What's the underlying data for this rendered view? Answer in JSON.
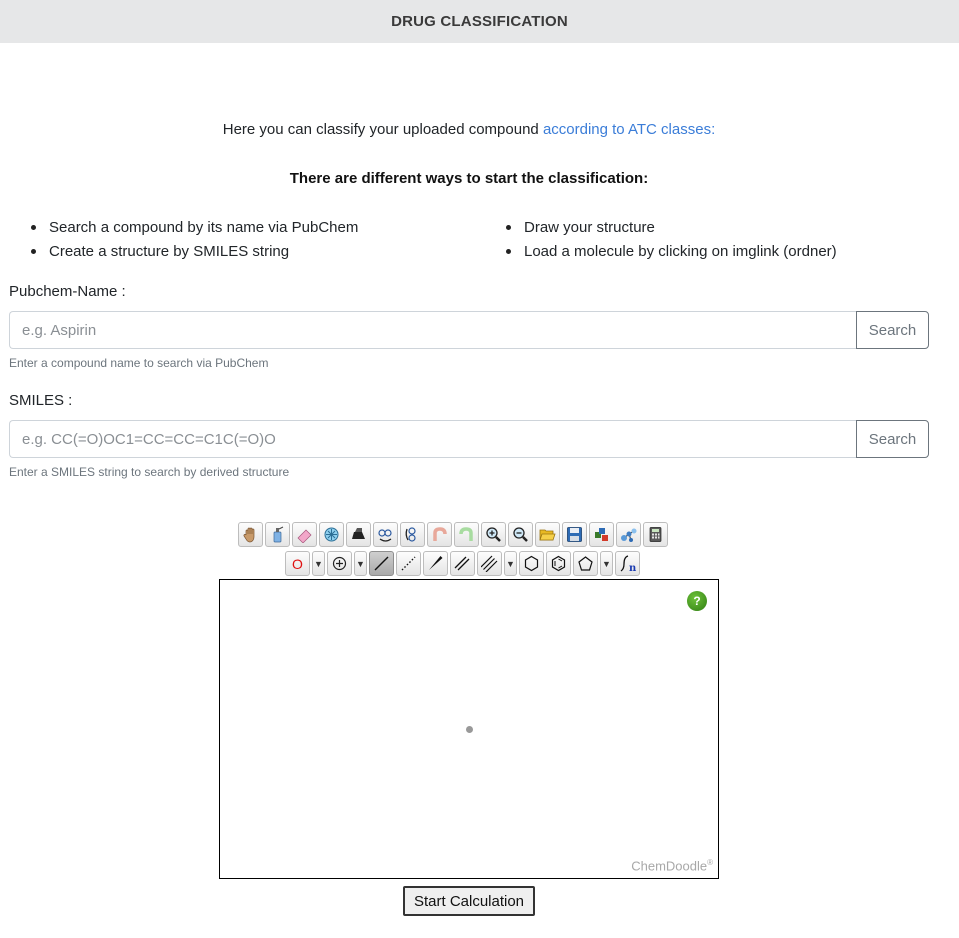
{
  "header": {
    "title": "DRUG CLASSIFICATION"
  },
  "intro": {
    "text": "Here you can classify your uploaded compound ",
    "link_text": "according to ATC classes:"
  },
  "ways": {
    "heading": "There are different ways to start the classification:",
    "left": [
      "Search a compound by its name via PubChem",
      "Create a structure by SMILES string"
    ],
    "right": [
      "Draw your structure",
      "Load a molecule by clicking on imglink (ordner)"
    ]
  },
  "pubchem": {
    "label": "Pubchem-Name :",
    "placeholder": "e.g. Aspirin",
    "button": "Search",
    "help": "Enter a compound name to search via PubChem"
  },
  "smiles": {
    "label": "SMILES :",
    "placeholder": "e.g. CC(=O)OC1=CC=CC=C1C(=O)O",
    "button": "Search",
    "help": "Enter a SMILES string to search by derived structure"
  },
  "sketcher": {
    "element_label": "O",
    "help_label": "?",
    "watermark": "ChemDoodle",
    "watermark_mark": "®",
    "icons_row1": [
      "hand-icon",
      "spray-icon",
      "eraser-icon",
      "center-icon",
      "flip-icon",
      "rotate-ccw-icon",
      "rotate-cw-icon",
      "undo-icon",
      "redo-icon",
      "zoom-in-icon",
      "zoom-out-icon",
      "open-icon",
      "save-icon",
      "templates-icon",
      "3d-icon",
      "calculator-icon"
    ],
    "colors": {
      "accent": "#3b7dd8",
      "help": "#3c8c1a",
      "element": "#e01010"
    }
  },
  "actions": {
    "start_label": "Start Calculation"
  }
}
